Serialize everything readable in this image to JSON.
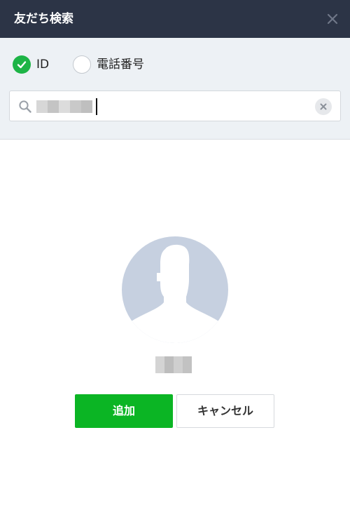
{
  "dialog": {
    "title": "友だち検索",
    "close_icon": "close-icon"
  },
  "search_type": {
    "options": [
      {
        "label": "ID",
        "checked": true
      },
      {
        "label": "電話番号",
        "checked": false
      }
    ]
  },
  "search": {
    "value_redacted": true,
    "search_icon": "search-icon",
    "clear_icon": "clear-icon"
  },
  "result": {
    "avatar_icon": "default-profile-silhouette",
    "name_redacted": true
  },
  "actions": {
    "add_label": "追加",
    "cancel_label": "キャンセル"
  },
  "colors": {
    "titlebar": "#2c3446",
    "search_area": "#edf1f5",
    "checked_radio": "#1db446",
    "add_button": "#0bb524",
    "avatar_bg": "#c6d0e0",
    "avatar_silhouette": "#ffffff"
  }
}
